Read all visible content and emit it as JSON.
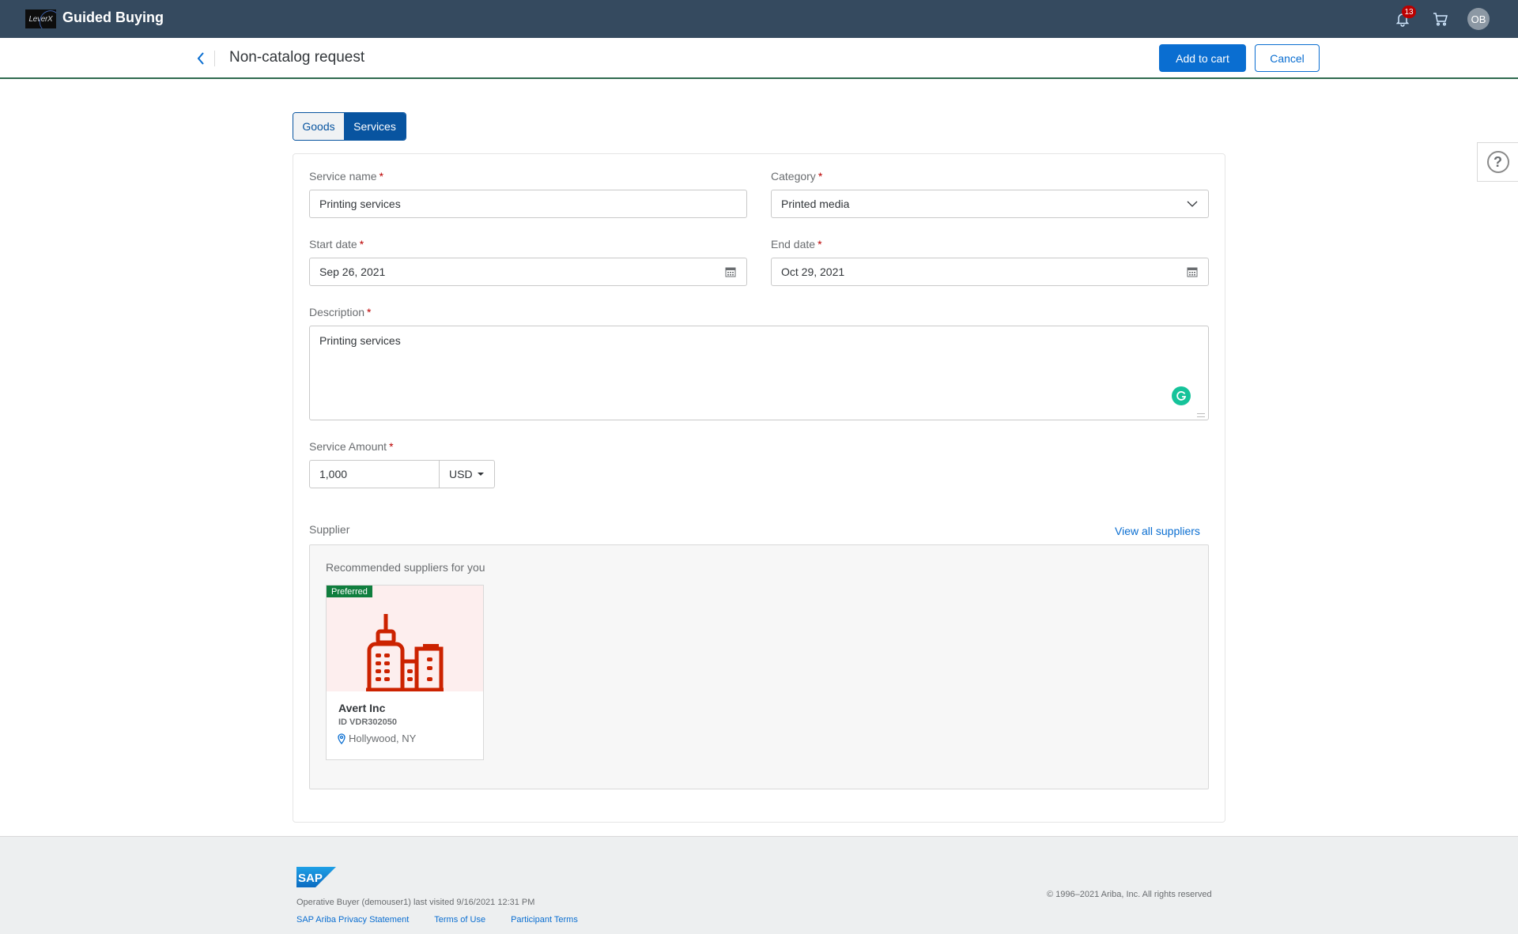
{
  "shell": {
    "logo_text": "LeverX",
    "app_title": "Guided Buying",
    "notifications_count": "13",
    "user_initials": "OB"
  },
  "header": {
    "title": "Non-catalog request",
    "add_to_cart_label": "Add to cart",
    "cancel_label": "Cancel"
  },
  "toggle": {
    "options": [
      {
        "label": "Goods",
        "selected": false
      },
      {
        "label": "Services",
        "selected": true
      }
    ]
  },
  "form": {
    "service_name": {
      "label": "Service name",
      "required_mark": "*",
      "value": "Printing services"
    },
    "category": {
      "label": "Category",
      "required_mark": "*",
      "value": "Printed media"
    },
    "start_date": {
      "label": "Start date",
      "required_mark": "*",
      "value": "Sep 26, 2021"
    },
    "end_date": {
      "label": "End date",
      "required_mark": "*",
      "value": "Oct 29, 2021"
    },
    "description": {
      "label": "Description",
      "required_mark": "*",
      "value": "Printing services"
    },
    "service_amount": {
      "label": "Service Amount",
      "required_mark": "*",
      "value": "1,000",
      "currency": "USD"
    }
  },
  "supplier": {
    "label": "Supplier",
    "view_all_label": "View all suppliers",
    "recommended_title": "Recommended suppliers for you",
    "cards": [
      {
        "tag": "Preferred",
        "name": "Avert Inc",
        "id": "ID VDR302050",
        "location": "Hollywood, NY"
      }
    ]
  },
  "footer": {
    "logo_text": "SAP",
    "last_visited": "Operative Buyer (demouser1) last visited 9/16/2021 12:31 PM",
    "links": [
      "SAP Ariba Privacy Statement",
      "Terms of Use",
      "Participant Terms"
    ],
    "copyright": "© 1996–2021 Ariba, Inc. All rights reserved"
  },
  "colors": {
    "shellbar": "#354a5f",
    "accent": "#0a6ed1",
    "toggle_active": "#0854a0",
    "preferred_tag": "#107e3e",
    "required": "#bb0000",
    "supplier_icon": "#cc2200"
  }
}
